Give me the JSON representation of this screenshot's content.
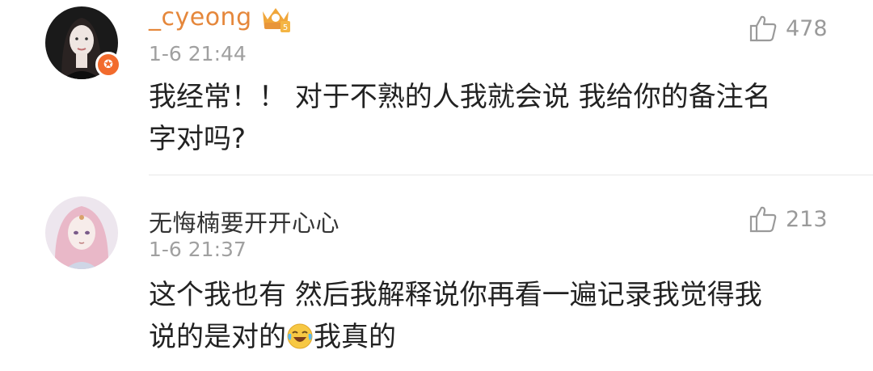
{
  "comments": [
    {
      "username": "_cyeong",
      "time": "1-6 21:44",
      "likes": "478",
      "content_line1": "我经常！！ 对于不熟的人我就会说 我给你的备注名",
      "content_line2": "字对吗?",
      "avatar_badge": "✪",
      "badge_icon": "crown-icon"
    },
    {
      "username": "无悔楠要开开心心",
      "time": "1-6 21:37",
      "likes": "213",
      "content_line1": "这个我也有 然后我解释说你再看一遍记录我觉得我",
      "content_line2_a": "说的是对的",
      "content_line2_b": "我真的",
      "emoji": "laugh-cry-emoji"
    }
  ],
  "colors": {
    "vip_username": "#e5873b",
    "normal_username": "#333333",
    "meta_gray": "#a0a0a0"
  }
}
